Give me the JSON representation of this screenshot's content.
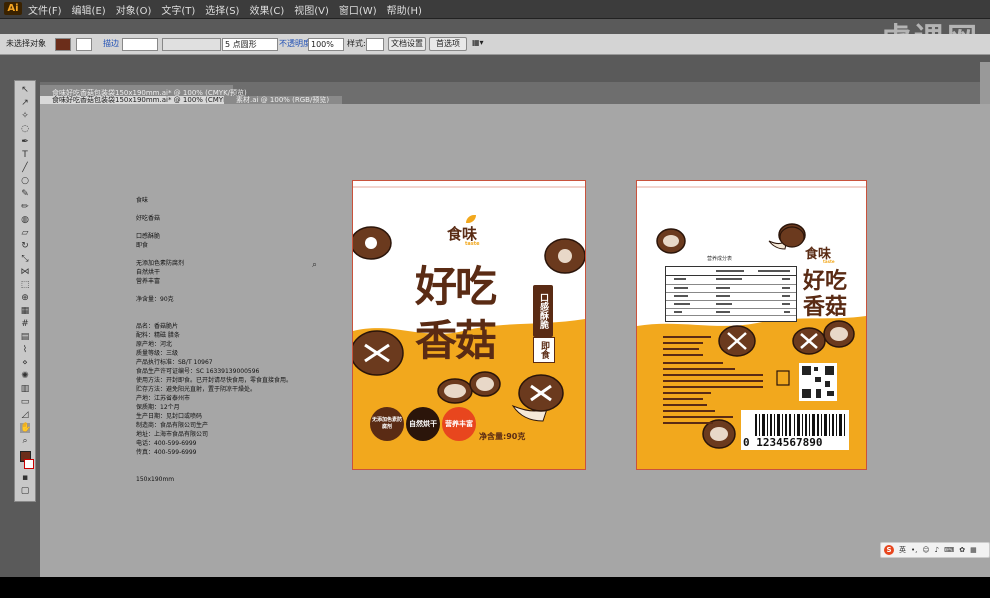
{
  "app": {
    "logo": "Ai",
    "watermark": "虎课网"
  },
  "menu": [
    "文件(F)",
    "编辑(E)",
    "对象(O)",
    "文字(T)",
    "选择(S)",
    "效果(C)",
    "视图(V)",
    "窗口(W)",
    "帮助(H)"
  ],
  "control_bar": {
    "selection": "未选择对象",
    "stroke_label": "描边",
    "point_style": "5 点圆形",
    "opacity_label": "不透明度",
    "opacity_value": "100%",
    "style_label": "样式:",
    "doc_setup": "文档设置",
    "preferences": "首选项"
  },
  "tabs": [
    {
      "label": "食味好吃香菇包装袋150x190mm.ai* @ 100% (CMYK/预览)",
      "active": false
    },
    {
      "label": "食味好吃香菇包装袋150x190mm.ai* @ 100% (CMYK/预览)",
      "active": true
    },
    {
      "label": "素材.ai @ 100% (RGB/预览)",
      "active": false
    }
  ],
  "notes": {
    "lines": "食味\n\n好吃香菇\n\n口感酥脆\n即食\n\n无添加色素防腐剂\n自然烘干\n营养丰富\n\n净含量：90克\n\n\n品名：香菇脆片\n配料：精磁 腊条\n原产地：河北\n质量等级：三级\n产品执行标准：SB/T 10967\n食品生产许可证编号：SC 16339139000596\n使用方法：开封即食。已开封请尽快食用，零食直接食用。\n贮存方法：避免阳光直射，置于阴凉干燥处。\n产地：江苏省泰州市\n保质期：12个月\n生产日期：见封口或喷码\n制造商：食品有限公司生产\n地址：上海市食品有限公司\n电话：400-599-6999\n传真：400-599-6999\n\n\n150x190mm"
  },
  "front": {
    "brand": "食味",
    "brand_en": "taste",
    "title_1": "好吃",
    "title_2": "香菇",
    "tag_1": "口感酥脆",
    "tag_2": "即食",
    "badge_1": "无添加色素防腐剂",
    "badge_2": "自然烘干",
    "badge_3": "营养丰富",
    "net_weight": "净含量:90克"
  },
  "back": {
    "brand": "食味",
    "brand_en": "taste",
    "title_1": "好吃",
    "title_2": "香菇",
    "table_title": "营养成分表",
    "barcode_number": "0 1234567890"
  },
  "status_bar": {
    "ime": "英"
  },
  "colors": {
    "brown": "#5a2b14",
    "orange": "#f2a81d",
    "border": "#c9523c",
    "canvas": "#a6a6a6",
    "badge_red": "#e8461e"
  }
}
